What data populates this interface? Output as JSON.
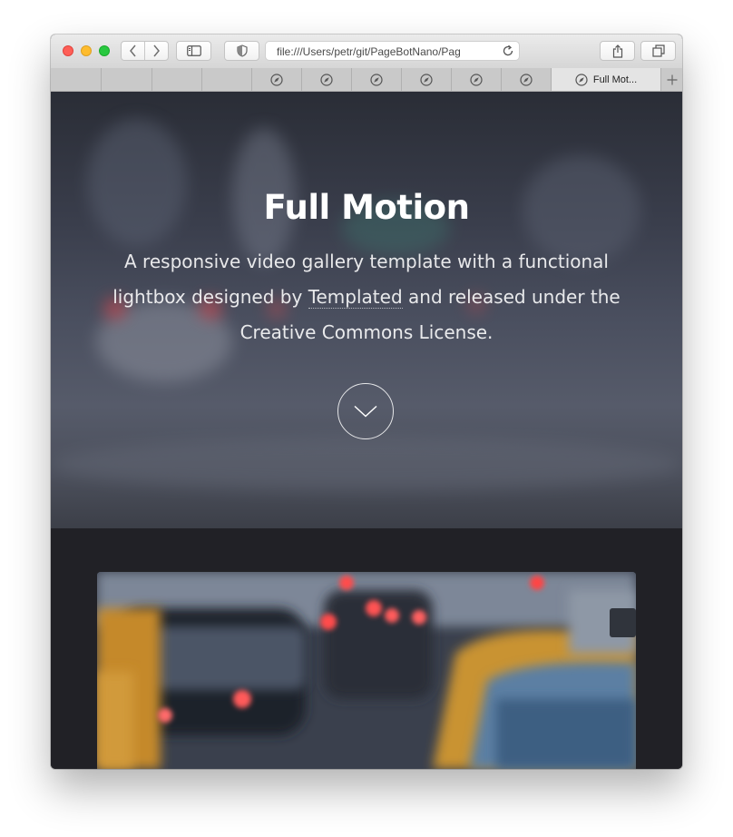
{
  "browser": {
    "url": "file:///Users/petr/git/PageBotNano/Pag",
    "tabs": [
      {
        "label": "",
        "icon": "none"
      },
      {
        "label": "",
        "icon": "none"
      },
      {
        "label": "",
        "icon": "none"
      },
      {
        "label": "",
        "icon": "none"
      },
      {
        "label": "",
        "icon": "compass-icon"
      },
      {
        "label": "",
        "icon": "compass-icon"
      },
      {
        "label": "",
        "icon": "compass-icon"
      },
      {
        "label": "",
        "icon": "compass-icon"
      },
      {
        "label": "",
        "icon": "compass-icon"
      },
      {
        "label": "",
        "icon": "compass-icon"
      },
      {
        "label": "Full Mot...",
        "icon": "compass-icon"
      }
    ],
    "active_tab_index": 10
  },
  "hero": {
    "title": "Full Motion",
    "text_before": "A responsive video gallery template with a functional lightbox designed by ",
    "link": "Templated",
    "text_after": " and released under the Creative Commons License."
  },
  "colors": {
    "page_background": "#212126",
    "hero_text": "#ffffff",
    "close_light": "#fe5f57",
    "minimize_light": "#febc2e",
    "zoom_light": "#28c840"
  }
}
